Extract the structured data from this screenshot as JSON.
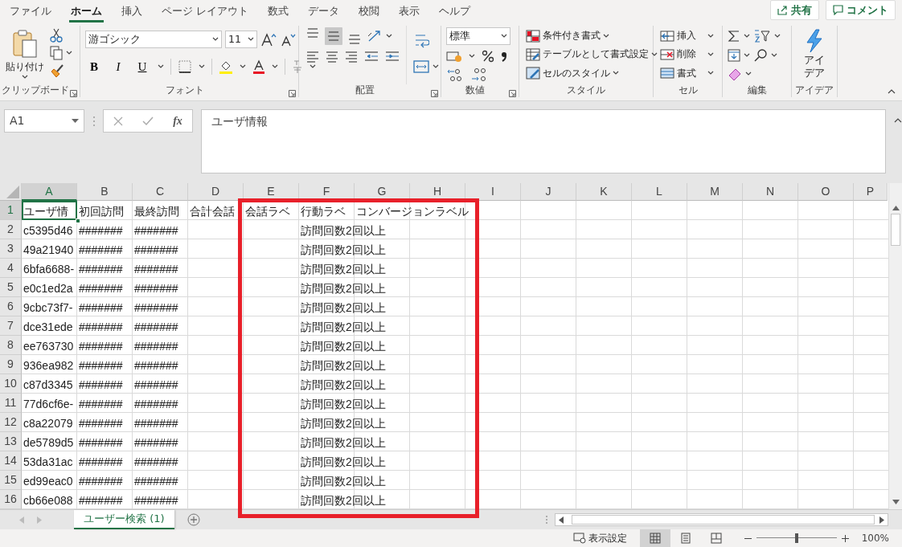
{
  "menu_tabs": [
    {
      "label": "ファイル",
      "selected": false
    },
    {
      "label": "ホーム",
      "selected": true
    },
    {
      "label": "挿入",
      "selected": false
    },
    {
      "label": "ページ レイアウト",
      "selected": false
    },
    {
      "label": "数式",
      "selected": false
    },
    {
      "label": "データ",
      "selected": false
    },
    {
      "label": "校閲",
      "selected": false
    },
    {
      "label": "表示",
      "selected": false
    },
    {
      "label": "ヘルプ",
      "selected": false
    }
  ],
  "share_button": "共有",
  "comment_button": "コメント",
  "clipboard": {
    "paste_label": "貼り付け",
    "group_label": "クリップボード"
  },
  "font": {
    "name": "游ゴシック",
    "size": "11",
    "format_buttons": [
      "B",
      "I",
      "U"
    ],
    "group_label": "フォント"
  },
  "alignment": {
    "vertical_buttons": [
      {
        "selected": false
      },
      {
        "selected": true
      },
      {
        "selected": false
      }
    ],
    "group_label": "配置"
  },
  "number": {
    "format": "標準",
    "group_label": "数値"
  },
  "styles": {
    "items": [
      "条件付き書式",
      "テーブルとして書式設定",
      "セルのスタイル"
    ],
    "group_label": "スタイル"
  },
  "cells": {
    "items": [
      "挿入",
      "削除",
      "書式"
    ],
    "group_label": "セル"
  },
  "editing": {
    "group_label": "編集"
  },
  "ideas": {
    "button": "アイデア",
    "group_label": "アイデア"
  },
  "name_box": "A1",
  "function_button": "fx",
  "formula": "ユーザ情報",
  "columns": [
    {
      "label": "A",
      "selected": true
    },
    {
      "label": "B",
      "selected": false
    },
    {
      "label": "C",
      "selected": false
    },
    {
      "label": "D",
      "selected": false
    },
    {
      "label": "E",
      "selected": false
    },
    {
      "label": "F",
      "selected": false
    },
    {
      "label": "G",
      "selected": false
    },
    {
      "label": "H",
      "selected": false
    },
    {
      "label": "I",
      "selected": false
    },
    {
      "label": "J",
      "selected": false
    },
    {
      "label": "K",
      "selected": false
    },
    {
      "label": "L",
      "selected": false
    },
    {
      "label": "M",
      "selected": false
    },
    {
      "label": "N",
      "selected": false
    },
    {
      "label": "O",
      "selected": false
    },
    {
      "label": "P",
      "selected": false
    }
  ],
  "rows": [
    {
      "number": "1",
      "selected": true,
      "cells": {
        "A": "ユーザ情",
        "B": "初回訪問",
        "C": "最終訪問",
        "D": "合計会話",
        "E": "会話ラベ",
        "F": "行動ラベ",
        "G": "コンバージョンラベル"
      }
    },
    {
      "number": "2",
      "selected": false,
      "cells": {
        "A": "c5395d46",
        "B": "#######",
        "C": "#######",
        "F": "訪問回数2回以上"
      }
    },
    {
      "number": "3",
      "selected": false,
      "cells": {
        "A": "49a21940",
        "B": "#######",
        "C": "#######",
        "F": "訪問回数2回以上"
      }
    },
    {
      "number": "4",
      "selected": false,
      "cells": {
        "A": "6bfa6688-",
        "B": "#######",
        "C": "#######",
        "F": "訪問回数2回以上"
      }
    },
    {
      "number": "5",
      "selected": false,
      "cells": {
        "A": "e0c1ed2a",
        "B": "#######",
        "C": "#######",
        "F": "訪問回数2回以上"
      }
    },
    {
      "number": "6",
      "selected": false,
      "cells": {
        "A": "9cbc73f7-",
        "B": "#######",
        "C": "#######",
        "F": "訪問回数2回以上"
      }
    },
    {
      "number": "7",
      "selected": false,
      "cells": {
        "A": "dce31ede",
        "B": "#######",
        "C": "#######",
        "F": "訪問回数2回以上"
      }
    },
    {
      "number": "8",
      "selected": false,
      "cells": {
        "A": "ee763730",
        "B": "#######",
        "C": "#######",
        "F": "訪問回数2回以上"
      }
    },
    {
      "number": "9",
      "selected": false,
      "cells": {
        "A": "936ea982",
        "B": "#######",
        "C": "#######",
        "F": "訪問回数2回以上"
      }
    },
    {
      "number": "10",
      "selected": false,
      "cells": {
        "A": "c87d3345",
        "B": "#######",
        "C": "#######",
        "F": "訪問回数2回以上"
      }
    },
    {
      "number": "11",
      "selected": false,
      "cells": {
        "A": "77d6cf6e-",
        "B": "#######",
        "C": "#######",
        "F": "訪問回数2回以上"
      }
    },
    {
      "number": "12",
      "selected": false,
      "cells": {
        "A": "c8a22079",
        "B": "#######",
        "C": "#######",
        "F": "訪問回数2回以上"
      }
    },
    {
      "number": "13",
      "selected": false,
      "cells": {
        "A": "de5789d5",
        "B": "#######",
        "C": "#######",
        "F": "訪問回数2回以上"
      }
    },
    {
      "number": "14",
      "selected": false,
      "cells": {
        "A": "53da31ac",
        "B": "#######",
        "C": "#######",
        "F": "訪問回数2回以上"
      }
    },
    {
      "number": "15",
      "selected": false,
      "cells": {
        "A": "ed99eac0",
        "B": "#######",
        "C": "#######",
        "F": "訪問回数2回以上"
      }
    },
    {
      "number": "16",
      "selected": false,
      "cells": {
        "A": "cb66e088",
        "B": "#######",
        "C": "#######",
        "F": "訪問回数2回以上"
      }
    }
  ],
  "sheet_tabs": [
    {
      "label": "ユーザー検索 (1)",
      "selected": true
    }
  ],
  "status_bar": {
    "display_settings": "表示設定",
    "views": [
      {
        "selected": true
      },
      {
        "selected": false
      },
      {
        "selected": false
      }
    ],
    "zoom": {
      "level": 0.5
    },
    "zoom_label": "100%"
  },
  "highlight_frame": true
}
